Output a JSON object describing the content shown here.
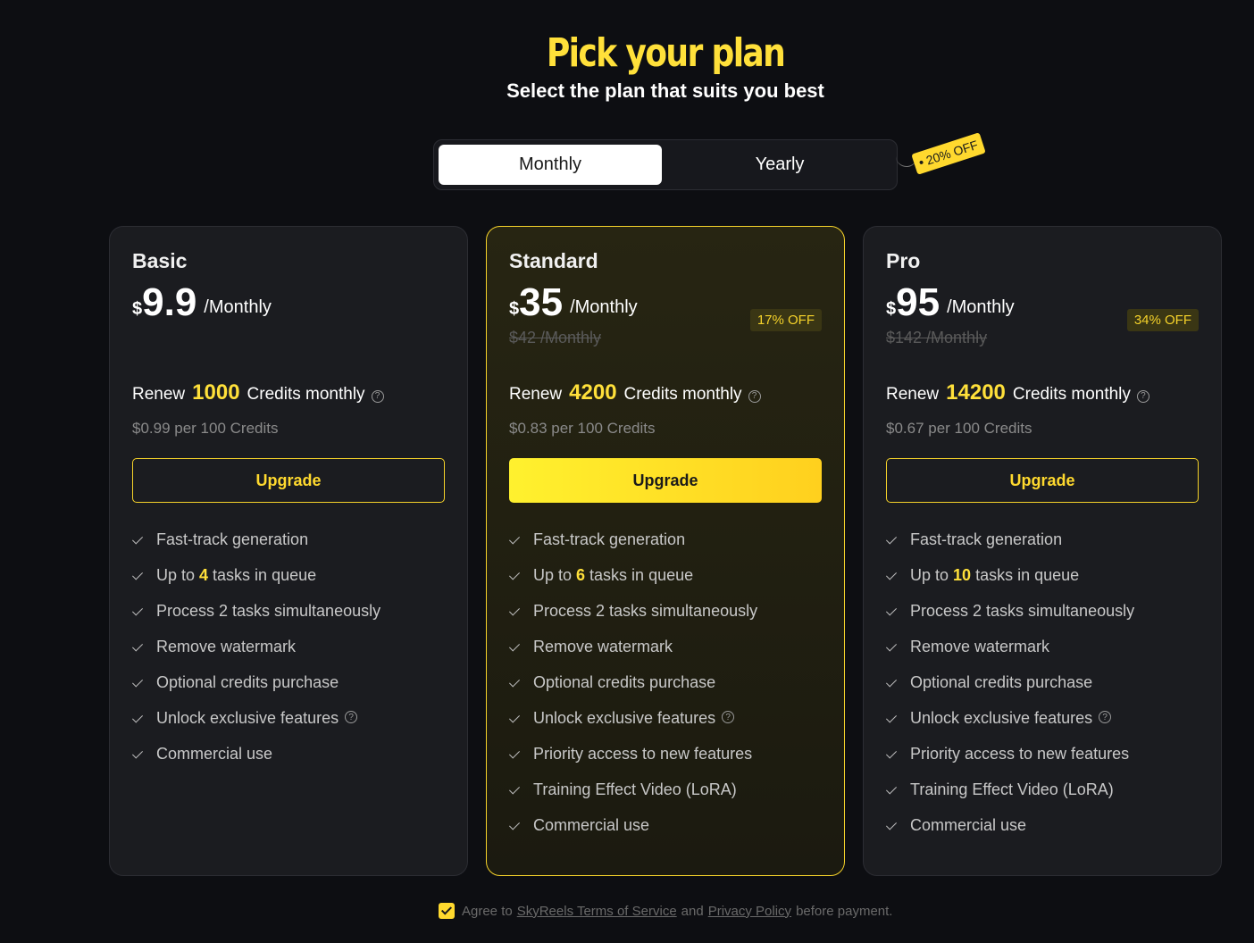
{
  "header": {
    "title": "Pick your plan",
    "subtitle": "Select the plan that suits you best"
  },
  "billing_toggle": {
    "monthly_label": "Monthly",
    "yearly_label": "Yearly",
    "selected": "Monthly",
    "discount_tag": "20% OFF"
  },
  "plans": [
    {
      "name": "Basic",
      "currency": "$",
      "price": "9.9",
      "period": "/Monthly",
      "original_price": "",
      "discount": "",
      "renew_prefix": "Renew",
      "credits": "1000",
      "renew_suffix": "Credits monthly",
      "rate": "$0.99 per 100 Credits",
      "button": "Upgrade",
      "queue_prefix": "Up to",
      "queue_count": "4",
      "queue_suffix": "tasks in queue",
      "features": {
        "f1": "Fast-track generation",
        "f3": "Process 2 tasks simultaneously",
        "f4": "Remove watermark",
        "f5": "Optional credits purchase",
        "f6": "Unlock exclusive features",
        "f7": "Commercial use"
      }
    },
    {
      "name": "Standard",
      "currency": "$",
      "price": "35",
      "period": "/Monthly",
      "original_price": "$42 /Monthly",
      "discount": "17% OFF",
      "renew_prefix": "Renew",
      "credits": "4200",
      "renew_suffix": "Credits monthly",
      "rate": "$0.83 per 100 Credits",
      "button": "Upgrade",
      "queue_prefix": "Up to",
      "queue_count": "6",
      "queue_suffix": "tasks in queue",
      "features": {
        "f1": "Fast-track generation",
        "f3": "Process 2 tasks simultaneously",
        "f4": "Remove watermark",
        "f5": "Optional credits purchase",
        "f6": "Unlock exclusive features",
        "f7": "Priority access to new features",
        "f8": "Training Effect Video (LoRA)",
        "f9": "Commercial use"
      }
    },
    {
      "name": "Pro",
      "currency": "$",
      "price": "95",
      "period": "/Monthly",
      "original_price": "$142 /Monthly",
      "discount": "34% OFF",
      "renew_prefix": "Renew",
      "credits": "14200",
      "renew_suffix": "Credits monthly",
      "rate": "$0.67 per 100 Credits",
      "button": "Upgrade",
      "queue_prefix": "Up to",
      "queue_count": "10",
      "queue_suffix": "tasks in queue",
      "features": {
        "f1": "Fast-track generation",
        "f3": "Process 2 tasks simultaneously",
        "f4": "Remove watermark",
        "f5": "Optional credits purchase",
        "f6": "Unlock exclusive features",
        "f7": "Priority access to new features",
        "f8": "Training Effect Video (LoRA)",
        "f9": "Commercial use"
      }
    }
  ],
  "agreement": {
    "checked": true,
    "prefix": "Agree to",
    "terms_link": "SkyReels Terms of Service",
    "and": "and",
    "privacy_link": "Privacy Policy",
    "suffix": "before payment."
  },
  "colors": {
    "accent": "#ffe03a",
    "background": "#0d0e12",
    "card": "#1b1c20"
  }
}
